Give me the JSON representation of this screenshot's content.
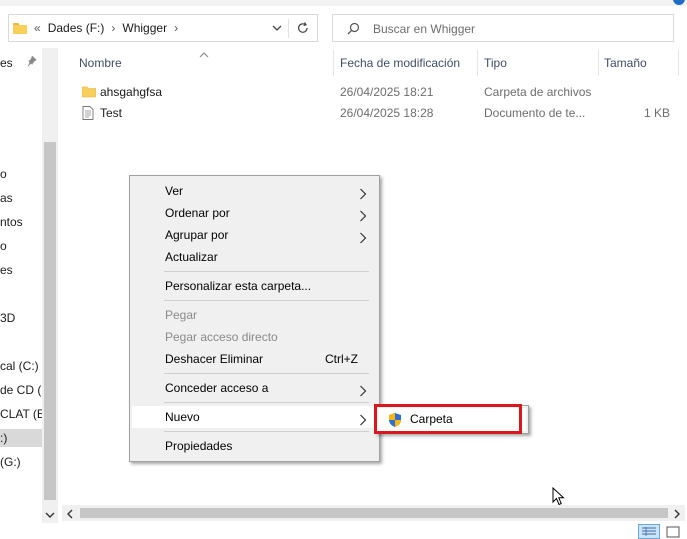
{
  "address_bar": {
    "back_chevrons": "«",
    "crumbs": [
      "Dades (F:)",
      "Whigger"
    ],
    "separator": "›"
  },
  "search": {
    "placeholder": "Buscar en Whigger"
  },
  "nav_pane": {
    "items": [
      "es",
      "o",
      "as",
      "ntos",
      "o",
      "es",
      "3D",
      "cal (C:)",
      "de CD (D",
      "CLAT (E:",
      ":)",
      "(G:)"
    ],
    "selected_index": 10
  },
  "columns": {
    "name": "Nombre",
    "modified": "Fecha de modificación",
    "type": "Tipo",
    "size": "Tamaño"
  },
  "files": [
    {
      "name": "ahsgahgfsa",
      "icon": "folder-icon",
      "modified": "26/04/2025 18:21",
      "type": "Carpeta de archivos",
      "size": ""
    },
    {
      "name": "Test",
      "icon": "text-file-icon",
      "modified": "26/04/2025 18:28",
      "type": "Documento de te...",
      "size": "1 KB"
    }
  ],
  "context_menu": {
    "items": [
      {
        "label": "Ver",
        "submenu": true
      },
      {
        "label": "Ordenar por",
        "submenu": true
      },
      {
        "label": "Agrupar por",
        "submenu": true
      },
      {
        "label": "Actualizar"
      },
      {
        "label": "Personalizar esta carpeta..."
      },
      {
        "label": "Pegar",
        "disabled": true
      },
      {
        "label": "Pegar acceso directo",
        "disabled": true
      },
      {
        "label": "Deshacer Eliminar",
        "shortcut": "Ctrl+Z"
      },
      {
        "label": "Conceder acceso a",
        "submenu": true
      },
      {
        "label": "Nuevo",
        "submenu": true,
        "active": true
      },
      {
        "label": "Propiedades"
      }
    ]
  },
  "submenu": {
    "item": {
      "label": "Carpeta",
      "icon": "shield-icon"
    },
    "highlight_color": "#d8181e"
  },
  "colors": {
    "accent": "#1e6cc4",
    "folder": "#f7cf5a",
    "menu_bg": "#f0f0f0",
    "header_text": "#3f4f66",
    "secondary_text": "#6d6d6d"
  }
}
